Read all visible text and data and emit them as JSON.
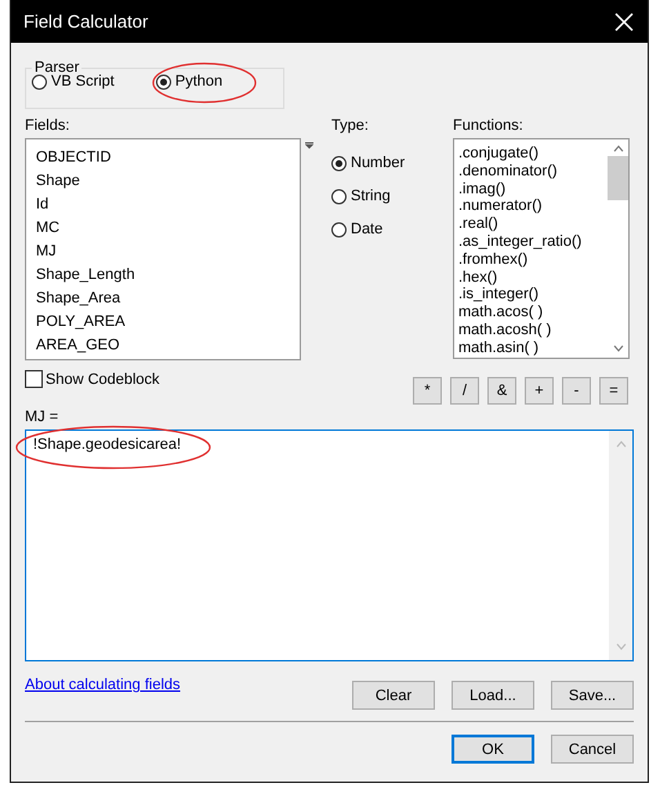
{
  "window": {
    "title": "Field Calculator"
  },
  "parser": {
    "label": "Parser",
    "options": [
      {
        "label": "VB Script",
        "selected": false
      },
      {
        "label": "Python",
        "selected": true
      }
    ]
  },
  "fields": {
    "label": "Fields:",
    "items": [
      "OBJECTID",
      "Shape",
      "Id",
      "MC",
      "MJ",
      "Shape_Length",
      "Shape_Area",
      "POLY_AREA",
      "AREA_GEO"
    ]
  },
  "type": {
    "label": "Type:",
    "options": [
      {
        "label": "Number",
        "selected": true
      },
      {
        "label": "String",
        "selected": false
      },
      {
        "label": "Date",
        "selected": false
      }
    ]
  },
  "functions": {
    "label": "Functions:",
    "items": [
      ".conjugate()",
      ".denominator()",
      ".imag()",
      ".numerator()",
      ".real()",
      ".as_integer_ratio()",
      ".fromhex()",
      ".hex()",
      ".is_integer()",
      "math.acos( )",
      "math.acosh( )",
      "math.asin( )"
    ]
  },
  "operators": [
    "*",
    "/",
    "&",
    "+",
    "-",
    "="
  ],
  "show_codeblock": {
    "label": "Show Codeblock",
    "checked": false
  },
  "expression": {
    "label": "MJ =",
    "value": "!Shape.geodesicarea!"
  },
  "help_link": "About calculating fields",
  "buttons": [
    "Clear",
    "Load...",
    "Save..."
  ],
  "dialog_buttons": [
    "OK",
    "Cancel"
  ]
}
